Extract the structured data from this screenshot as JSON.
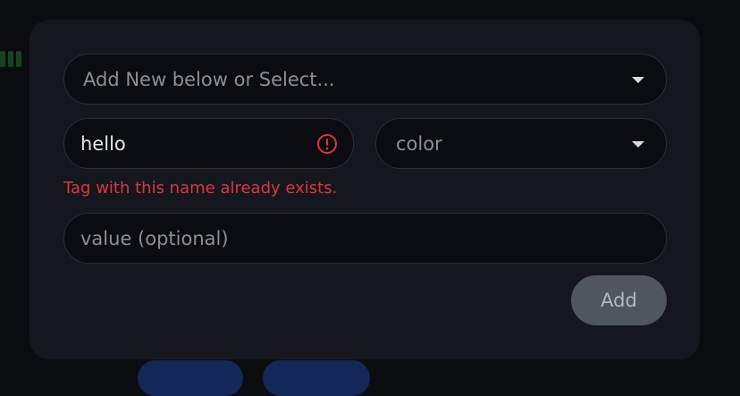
{
  "form": {
    "tag_select_placeholder": "Add New below or Select...",
    "name_value": "hello",
    "color_placeholder": "color",
    "error_message": "Tag with this name already exists.",
    "value_placeholder": "value (optional)",
    "add_label": "Add"
  },
  "colors": {
    "error": "#e0343c",
    "modal_bg": "#14171e",
    "field_bg": "#0a0c11",
    "button_bg": "#4f565d"
  },
  "icons": {
    "tag_select_caret": "chevron-down-icon",
    "color_select_caret": "chevron-down-icon",
    "name_error": "error-circle-icon"
  }
}
